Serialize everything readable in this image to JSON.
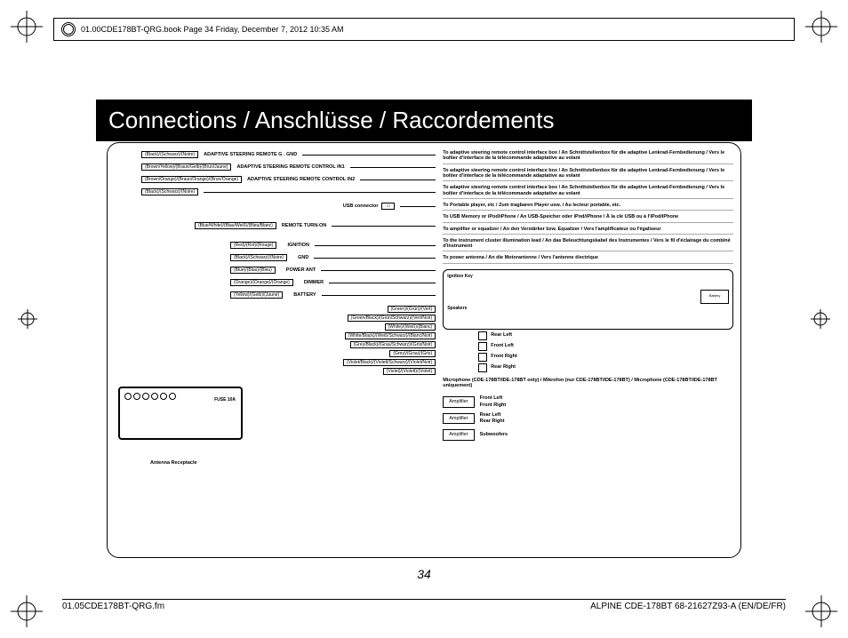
{
  "print_meta": "01.00CDE178BT-QRG.book  Page 34  Friday, December 7, 2012  10:35 AM",
  "title": "Connections / Anschlüsse / Raccordements",
  "page_number": "34",
  "footer_left": "01.05CDE178BT-QRG.fm",
  "footer_right": "ALPINE CDE-178BT 68-21627Z93-A (EN/DE/FR)",
  "wires_top": [
    {
      "color": "(Black)/(Schwarz)/(Noire)",
      "label": "ADAPTIVE STEERING REMOTE G . GND"
    },
    {
      "color": "(Brown/Yellow)/(Braun/Gelb)/(Brun/Jaune)",
      "label": "ADAPTIVE STEERING REMOTE CONTROL IN1"
    },
    {
      "color": "(Brown/Orange)/(Braun/Orange)/(Brun/Orange)",
      "label": "ADAPTIVE STEERING REMOTE CONTROL IN2"
    },
    {
      "color": "(Black)/(Schwarz)/(Noire)",
      "label": ""
    }
  ],
  "usb_label": "USB connector",
  "wires_mid": [
    {
      "color": "(Blue/White)/(Blau/Weiß)/(Bleu/Blanc)",
      "label": "REMOTE TURN-ON"
    }
  ],
  "wires_signal": [
    {
      "color": "(Red)/(Rot)/(Rouge)",
      "label": "IGNITION"
    },
    {
      "color": "(Black)/(Schwarz)/(Noire)",
      "label": "GND"
    },
    {
      "color": "(Blue)/(Blau)/(Bleu)",
      "label": "POWER ANT"
    },
    {
      "color": "(Orange)/(Orange)/(Orange)",
      "label": "DIMMER"
    },
    {
      "color": "(Yellow)/(Gelb)/(Jaune)",
      "label": "BATTERY"
    }
  ],
  "wires_speaker": [
    {
      "color": "(Green)/(Grün)/(Vert)"
    },
    {
      "color": "(Green/Black)/(Grün/Schwarz)/(Vert/Noir)"
    },
    {
      "color": "(White)/(Weiß)/(Blanc)"
    },
    {
      "color": "(White/Black)/(Weiß/Schwarz)/(Blanc/Noir)"
    },
    {
      "color": "(Grey/Black)/(Grau/Schwarz)/(Gris/Noir)"
    },
    {
      "color": "(Grey)/(Grau)/(Gris)"
    },
    {
      "color": "(Violet/Black)/(Violett/Schwarz)/(Violet/Noir)"
    },
    {
      "color": "(Violet)/(Violett)/(Violet)"
    }
  ],
  "fuse": "FUSE 10A",
  "antenna": "Antenna Receptacle",
  "dests": [
    "To adaptive steering remote control interface box / An Schnittstellenbox für die adaptive Lenkrad-Fernbedienung / Vers le boîtier d'interface de la télécommande adaptative au volant",
    "To adaptive steering remote control interface box / An Schnittstellenbox für die adaptive Lenkrad-Fernbedienung / Vers le boîtier d'interface de la télécommande adaptative au volant",
    "To adaptive steering remote control interface box / An Schnittstellenbox für die adaptive Lenkrad-Fernbedienung / Vers le boîtier d'interface de la télécommande adaptative au volant",
    "To Portable player, etc / Zum tragbaren Player usw. / Au lecteur portable, etc.",
    "To USB Memory or iPod/iPhone / An USB-Speicher oder iPod/iPhone / À la clé USB ou à l'iPod/iPhone",
    "To amplifier or equalizer / An den Verstärker bzw. Equalizer / Vers l'amplificateur ou l'égaliseur",
    "To the instrument cluster illumination lead / An das Beleuchtungskabel des Instrumentes / Vers le fil d'éclairage du combiné d'instrument",
    "To power antenna / An die Motorantenne / Vers l'antenne électrique"
  ],
  "car": {
    "ignition": "Ignition Key",
    "speakers": "Speakers",
    "battery": "Battery"
  },
  "speakers": [
    "Rear Left",
    "Front Left",
    "Front Right",
    "Rear Right"
  ],
  "mic": "Microphone (CDE-178BT/IDE-178BT only) / Mikrofon (nur CDE-178BT/IDE-178BT) / Microphone (CDE-178BT/IDE-178BT uniquement)",
  "amps": [
    {
      "label": "Amplifier",
      "outs": [
        "Front Left",
        "Front Right"
      ]
    },
    {
      "label": "Amplifier",
      "outs": [
        "Rear Left",
        "Rear Right"
      ]
    },
    {
      "label": "Amplifier",
      "outs": [
        "Subwoofers"
      ]
    }
  ]
}
